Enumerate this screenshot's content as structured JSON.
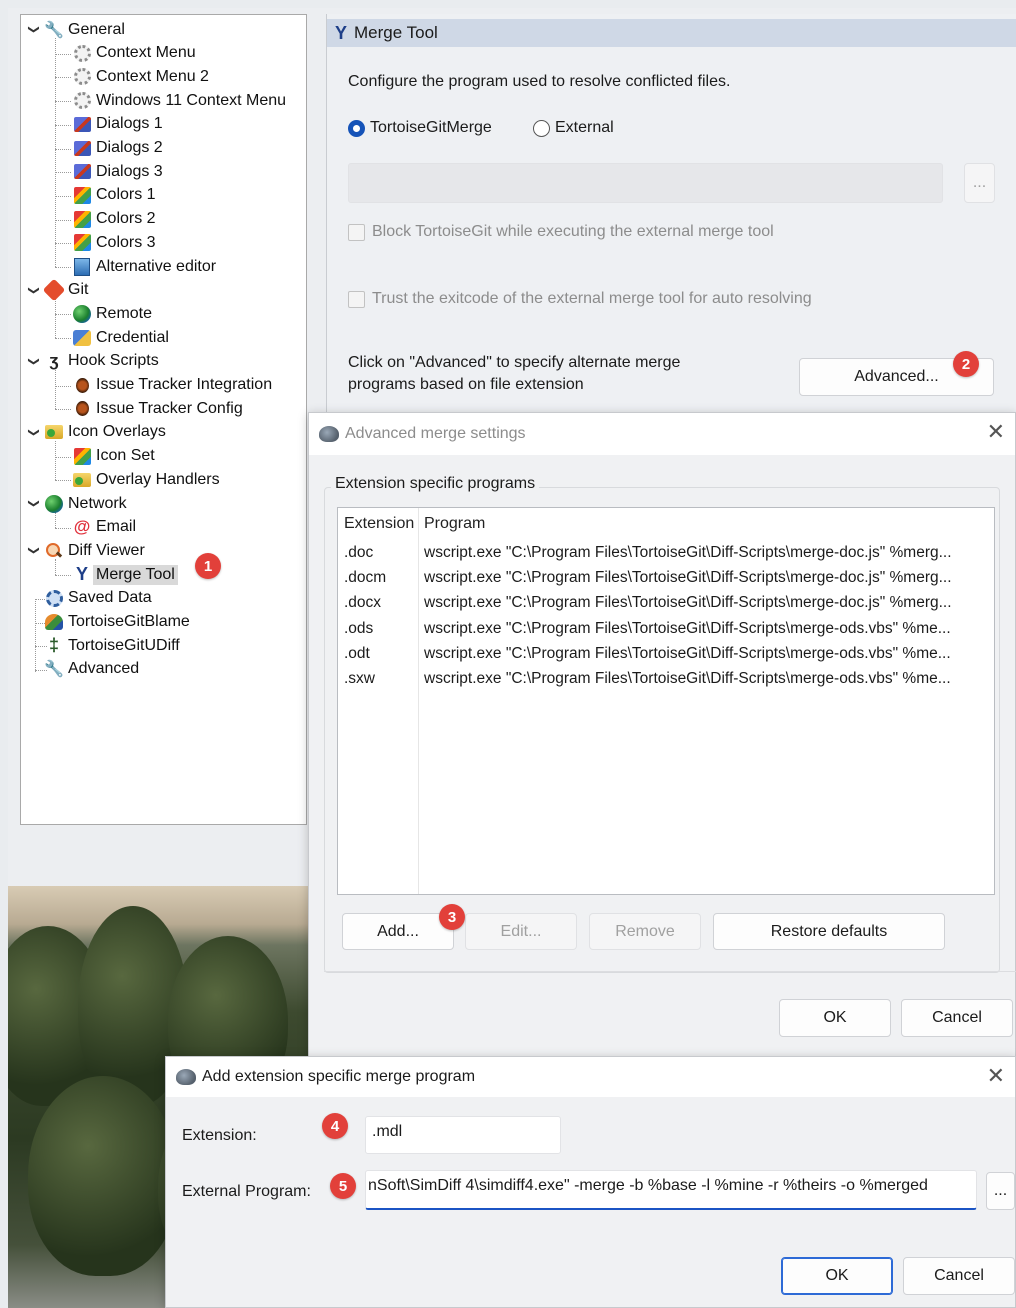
{
  "tree": {
    "items": [
      {
        "label": "General",
        "icon": "wrench-icon",
        "level": 0,
        "expanded": true
      },
      {
        "label": "Context Menu",
        "icon": "gear-icon",
        "level": 1
      },
      {
        "label": "Context Menu 2",
        "icon": "gear-icon",
        "level": 1
      },
      {
        "label": "Windows 11 Context Menu",
        "icon": "gear-icon",
        "level": 1
      },
      {
        "label": "Dialogs 1",
        "icon": "dialogs-icon",
        "level": 1
      },
      {
        "label": "Dialogs 2",
        "icon": "dialogs-icon",
        "level": 1
      },
      {
        "label": "Dialogs 3",
        "icon": "dialogs-icon",
        "level": 1
      },
      {
        "label": "Colors 1",
        "icon": "colors-icon",
        "level": 1
      },
      {
        "label": "Colors 2",
        "icon": "colors-icon",
        "level": 1
      },
      {
        "label": "Colors 3",
        "icon": "colors-icon",
        "level": 1
      },
      {
        "label": "Alternative editor",
        "icon": "editor-icon",
        "level": 1
      },
      {
        "label": "Git",
        "icon": "git-icon",
        "level": 0,
        "expanded": true
      },
      {
        "label": "Remote",
        "icon": "globe-icon",
        "level": 1
      },
      {
        "label": "Credential",
        "icon": "credential-icon",
        "level": 1
      },
      {
        "label": "Hook Scripts",
        "icon": "hook-icon",
        "level": 0,
        "expanded": true
      },
      {
        "label": "Issue Tracker Integration",
        "icon": "bug-icon",
        "level": 1
      },
      {
        "label": "Issue Tracker Config",
        "icon": "bug-icon",
        "level": 1
      },
      {
        "label": "Icon Overlays",
        "icon": "folder-overlay-icon",
        "level": 0,
        "expanded": true
      },
      {
        "label": "Icon Set",
        "icon": "colors-icon",
        "level": 1
      },
      {
        "label": "Overlay Handlers",
        "icon": "folder-overlay-icon",
        "level": 1
      },
      {
        "label": "Network",
        "icon": "globe-icon",
        "level": 0,
        "expanded": true
      },
      {
        "label": "Email",
        "icon": "email-icon",
        "level": 1
      },
      {
        "label": "Diff Viewer",
        "icon": "diff-search-icon",
        "level": 0,
        "expanded": true
      },
      {
        "label": "Merge Tool",
        "icon": "merge-icon",
        "level": 1,
        "selected": true
      },
      {
        "label": "Saved Data",
        "icon": "saved-data-icon",
        "level": 0
      },
      {
        "label": "TortoiseGitBlame",
        "icon": "blame-icon",
        "level": 0
      },
      {
        "label": "TortoiseGitUDiff",
        "icon": "udiff-icon",
        "level": 0
      },
      {
        "label": "Advanced",
        "icon": "wrench-icon",
        "level": 0
      }
    ]
  },
  "badges": [
    "1",
    "2",
    "3",
    "4",
    "5"
  ],
  "merge_page": {
    "title": "Merge Tool",
    "description": "Configure the program used to resolve conflicted files.",
    "radio_tortoise": "TortoiseGitMerge",
    "radio_external": "External",
    "selected_radio": "TortoiseGitMerge",
    "path_value": "",
    "browse_label": "...",
    "block_label": "Block TortoiseGit while executing the external merge tool",
    "trust_label": "Trust the exitcode of the external merge tool for auto resolving",
    "advanced_hint_line1": "Click on \"Advanced\" to specify alternate merge",
    "advanced_hint_line2": "programs based on file extension",
    "advanced_button": "Advanced..."
  },
  "advanced_dialog": {
    "title": "Advanced merge settings",
    "group_label": "Extension specific programs",
    "columns": [
      "Extension",
      "Program"
    ],
    "rows": [
      {
        "ext": ".doc",
        "program": "wscript.exe \"C:\\Program Files\\TortoiseGit\\Diff-Scripts\\merge-doc.js\" %merg..."
      },
      {
        "ext": ".docm",
        "program": "wscript.exe \"C:\\Program Files\\TortoiseGit\\Diff-Scripts\\merge-doc.js\" %merg..."
      },
      {
        "ext": ".docx",
        "program": "wscript.exe \"C:\\Program Files\\TortoiseGit\\Diff-Scripts\\merge-doc.js\" %merg..."
      },
      {
        "ext": ".ods",
        "program": "wscript.exe \"C:\\Program Files\\TortoiseGit\\Diff-Scripts\\merge-ods.vbs\" %me..."
      },
      {
        "ext": ".odt",
        "program": "wscript.exe \"C:\\Program Files\\TortoiseGit\\Diff-Scripts\\merge-ods.vbs\" %me..."
      },
      {
        "ext": ".sxw",
        "program": "wscript.exe \"C:\\Program Files\\TortoiseGit\\Diff-Scripts\\merge-ods.vbs\" %me..."
      }
    ],
    "add_button": "Add...",
    "edit_button": "Edit...",
    "remove_button": "Remove",
    "restore_button": "Restore defaults",
    "ok_button": "OK",
    "cancel_button": "Cancel"
  },
  "add_dialog": {
    "title": "Add extension specific merge program",
    "extension_label": "Extension:",
    "extension_value": ".mdl",
    "program_label": "External Program:",
    "program_value": "nSoft\\SimDiff 4\\simdiff4.exe\" -merge -b %base -l %mine -r %theirs -o %merged",
    "browse_label": "...",
    "ok_button": "OK",
    "cancel_button": "Cancel"
  },
  "colors": {
    "badge": "#e2403a",
    "accent": "#1553b8",
    "header": "#cfd8e6"
  }
}
